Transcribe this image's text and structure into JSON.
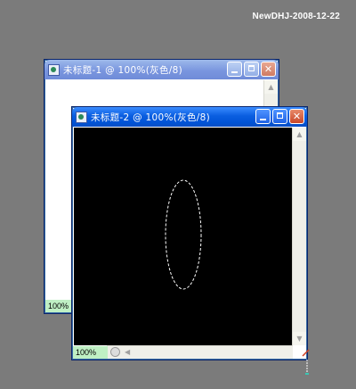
{
  "watermark": "NewDHJ-2008-12-22",
  "window_back": {
    "title": "未标题-1 @ 100%(灰色/8)",
    "zoom": "100%"
  },
  "window_front": {
    "title": "未标题-2 @ 100%(灰色/8)",
    "zoom": "100%"
  },
  "icons": {
    "minimize": "minimize-icon",
    "maximize": "maximize-icon",
    "close": "close-icon",
    "app": "photoshop-document-icon"
  },
  "colors": {
    "desktop": "#7b7b7b",
    "canvas_back": "#ffffff",
    "canvas_front": "#000000",
    "zoom_badge": "#bff0c4",
    "selection": "#ffffff"
  }
}
